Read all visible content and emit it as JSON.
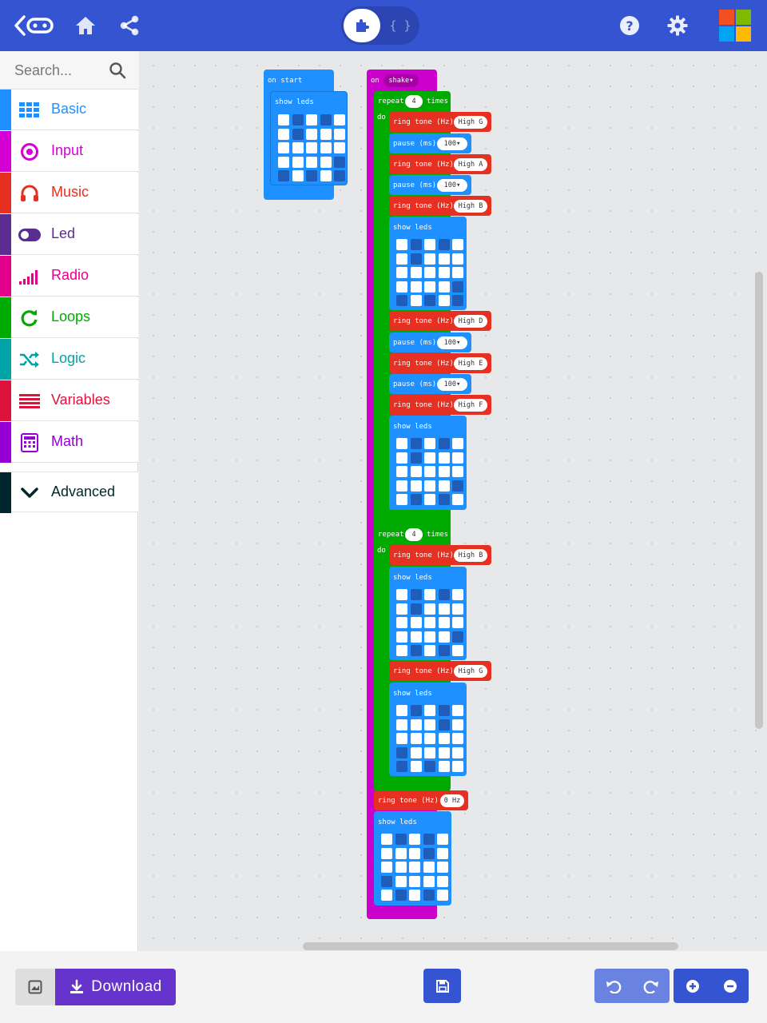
{
  "colors": {
    "topbar": "#3454d1",
    "basic": "#1e90ff",
    "input": "#d400d4",
    "music": "#e63022",
    "led": "#5c2d91",
    "radio": "#e3008c",
    "loops": "#00aa00",
    "logic": "#00a4a6",
    "variables": "#dc143c",
    "math": "#9400d3",
    "advanced": "#00272b",
    "download": "#6633cc"
  },
  "header": {
    "back_icon": "microbit-back-icon",
    "home_icon": "home-icon",
    "share_icon": "share-icon",
    "toggle_blocks_icon": "puzzle-icon",
    "toggle_code_label": "{ }",
    "help_icon": "help-icon",
    "settings_icon": "gear-icon",
    "logo": "microsoft-logo"
  },
  "sidebar": {
    "search_placeholder": "Search...",
    "categories": [
      {
        "label": "Basic",
        "icon": "grid-icon",
        "color": "#1e90ff"
      },
      {
        "label": "Input",
        "icon": "target-icon",
        "color": "#d400d4"
      },
      {
        "label": "Music",
        "icon": "headphones-icon",
        "color": "#e63022"
      },
      {
        "label": "Led",
        "icon": "toggle-icon",
        "color": "#5c2d91"
      },
      {
        "label": "Radio",
        "icon": "signal-bars-icon",
        "color": "#e3008c"
      },
      {
        "label": "Loops",
        "icon": "refresh-icon",
        "color": "#00aa00"
      },
      {
        "label": "Logic",
        "icon": "shuffle-icon",
        "color": "#00a4a6"
      },
      {
        "label": "Variables",
        "icon": "lines-icon",
        "color": "#dc143c"
      },
      {
        "label": "Math",
        "icon": "calculator-icon",
        "color": "#9400d3"
      },
      {
        "label": "Advanced",
        "icon": "chevron-down-icon",
        "color": "#00272b"
      }
    ]
  },
  "blocks": {
    "on_start": "on start",
    "show_leds": "show leds",
    "on": "on",
    "shake": "shake",
    "repeat": "repeat",
    "times": "times",
    "do": "do",
    "ring_tone": "ring tone (Hz)",
    "pause": "pause (ms)",
    "pause_value": "100",
    "repeat1_count": "4",
    "repeat2_count": "4",
    "notes": [
      "High G",
      "High A",
      "High B",
      "High D",
      "High E",
      "High F",
      "High B",
      "High G",
      "0 Hz"
    ],
    "led_patterns": [
      [
        1,
        0,
        1,
        0,
        1,
        1,
        0,
        1,
        1,
        1,
        1,
        1,
        1,
        1,
        1,
        1,
        1,
        1,
        1,
        0,
        0,
        1,
        0,
        1,
        0
      ],
      [
        1,
        0,
        1,
        0,
        1,
        1,
        0,
        1,
        1,
        1,
        1,
        1,
        1,
        1,
        1,
        1,
        1,
        1,
        1,
        0,
        0,
        1,
        0,
        1,
        0
      ],
      [
        1,
        0,
        1,
        0,
        1,
        1,
        0,
        1,
        1,
        1,
        1,
        1,
        1,
        1,
        1,
        1,
        1,
        1,
        1,
        0,
        1,
        0,
        1,
        0,
        1
      ],
      [
        1,
        0,
        1,
        0,
        1,
        1,
        0,
        1,
        1,
        1,
        1,
        1,
        1,
        1,
        1,
        1,
        1,
        1,
        1,
        0,
        1,
        0,
        1,
        0,
        1
      ],
      [
        1,
        0,
        1,
        0,
        1,
        1,
        1,
        1,
        0,
        1,
        1,
        1,
        1,
        1,
        1,
        0,
        1,
        1,
        1,
        1,
        0,
        1,
        0,
        1,
        1
      ],
      [
        1,
        0,
        1,
        0,
        1,
        1,
        1,
        1,
        0,
        1,
        1,
        1,
        1,
        1,
        1,
        0,
        1,
        1,
        1,
        1,
        1,
        0,
        1,
        0,
        1
      ],
      [
        1,
        0,
        1,
        0,
        1,
        1,
        1,
        0,
        1,
        1,
        1,
        1,
        1,
        1,
        1,
        0,
        1,
        1,
        1,
        0,
        0,
        1,
        0,
        1,
        0
      ]
    ]
  },
  "bottombar": {
    "screenshot_icon": "screenshot-icon",
    "download_label": "Download",
    "download_icon": "download-icon",
    "save_icon": "save-icon",
    "undo_icon": "undo-icon",
    "redo_icon": "redo-icon",
    "zoom_in_icon": "zoom-in-icon",
    "zoom_out_icon": "zoom-out-icon"
  }
}
